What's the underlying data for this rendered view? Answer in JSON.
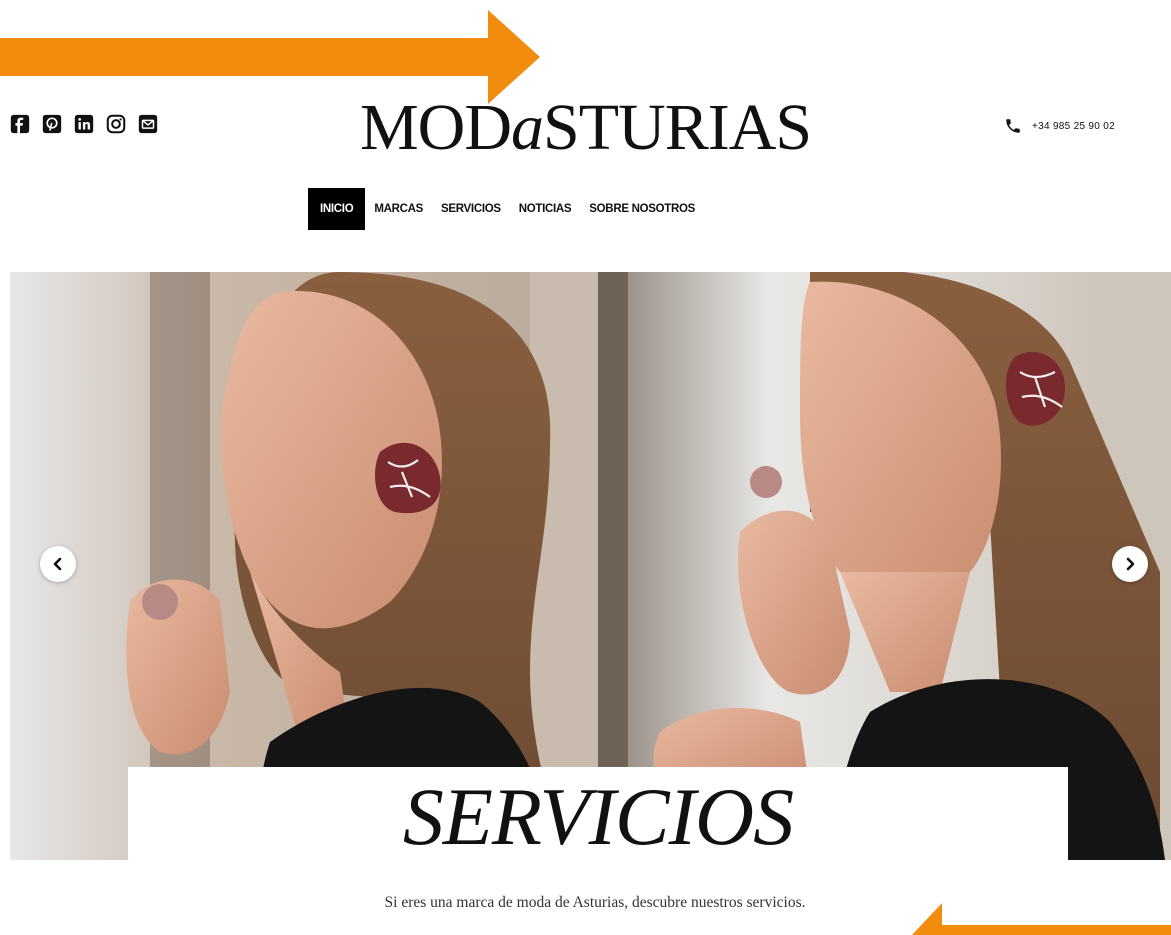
{
  "social": [
    "facebook-icon",
    "pinterest-icon",
    "linkedin-icon",
    "instagram-icon",
    "mail-icon"
  ],
  "logo": {
    "prefix": "MOD",
    "accent": "a",
    "suffix": "STURIAS"
  },
  "phone": {
    "icon": "phone-icon",
    "number": "+34 985 25 90 02"
  },
  "nav": {
    "items": [
      {
        "label": "INICIO",
        "active": true
      },
      {
        "label": "MARCAS",
        "active": false
      },
      {
        "label": "SERVICIOS",
        "active": false
      },
      {
        "label": "NOTICIAS",
        "active": false
      },
      {
        "label": "SOBRE NOSOTROS",
        "active": false
      }
    ]
  },
  "hero": {
    "prev_icon": "chevron-left-icon",
    "next_icon": "chevron-right-icon",
    "title": "SERVICIOS",
    "subtitle": "Si eres una marca de moda de Asturias, descubre nuestros servicios."
  },
  "colors": {
    "annotation": "#F28C0F",
    "nav_active_bg": "#000000",
    "text": "#111111"
  }
}
